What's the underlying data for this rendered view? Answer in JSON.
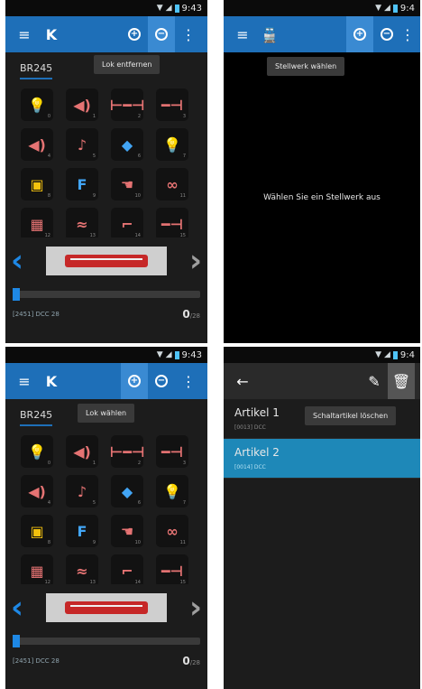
{
  "status": {
    "time_full": "9:43",
    "time_cut": "9:4"
  },
  "screen_tl": {
    "tooltip": "Lok entfernen",
    "lok_tab": "BR245",
    "address": "[2451] DCC 28",
    "speed_value": "0",
    "speed_max": "/28",
    "speed_fraction": 0.0,
    "icons": {
      "menu": "menu-icon",
      "app": "k-logo-icon",
      "add": "add-circle-icon",
      "remove": "remove-circle-icon",
      "more": "more-vert-icon"
    },
    "functions": [
      {
        "icon": "lightbulb-icon",
        "glyph": "💡",
        "color": "#f4c20d",
        "num": "0"
      },
      {
        "icon": "horn-icon",
        "glyph": "◀)",
        "color": "#e57373",
        "num": "1"
      },
      {
        "icon": "coupler-icon",
        "glyph": "⊢━⊣",
        "color": "#e57373",
        "num": "2"
      },
      {
        "icon": "coupler-icon",
        "glyph": "━⊣",
        "color": "#e57373",
        "num": "3"
      },
      {
        "icon": "horn-icon",
        "glyph": "◀)",
        "color": "#e57373",
        "num": "4"
      },
      {
        "icon": "whistle-icon",
        "glyph": "♪",
        "color": "#e57373",
        "num": "5"
      },
      {
        "icon": "shunting-icon",
        "glyph": "◆",
        "color": "#42a5f5",
        "num": "6"
      },
      {
        "icon": "lightbulb-icon",
        "glyph": "💡",
        "color": "#f4c20d",
        "num": "7"
      },
      {
        "icon": "cab-light-icon",
        "glyph": "▣",
        "color": "#f4c20d",
        "num": "8"
      },
      {
        "icon": "function-f-icon",
        "glyph": "F",
        "color": "#42a5f5",
        "num": "9"
      },
      {
        "icon": "hand-icon",
        "glyph": "☚",
        "color": "#e57373",
        "num": "10"
      },
      {
        "icon": "link-icon",
        "glyph": "∞",
        "color": "#e57373",
        "num": "11"
      },
      {
        "icon": "grid-icon",
        "glyph": "▦",
        "color": "#e57373",
        "num": "12"
      },
      {
        "icon": "brake-icon",
        "glyph": "≈",
        "color": "#e57373",
        "num": "13"
      },
      {
        "icon": "crane-icon",
        "glyph": "⌐",
        "color": "#e57373",
        "num": "14"
      },
      {
        "icon": "coupler-icon",
        "glyph": "━⊣",
        "color": "#e57373",
        "num": "15"
      }
    ]
  },
  "screen_tr": {
    "tooltip": "Stellwerk wählen",
    "message": "Wählen Sie ein Stellwerk aus"
  },
  "screen_bl": {
    "tooltip": "Lok wählen",
    "lok_tab": "BR245",
    "address": "[2451] DCC 28",
    "speed_value": "0",
    "speed_max": "/28",
    "speed_fraction": 0.0
  },
  "screen_br": {
    "tooltip": "Schaltartikel löschen",
    "items": [
      {
        "title": "Artikel 1",
        "sub": "[0013] DCC"
      },
      {
        "title": "Artikel 2",
        "sub": "[0014] DCC"
      }
    ]
  },
  "colors": {
    "appbar": "#1e6fb8",
    "accent": "#1e88e5",
    "selected": "#1e88b8"
  }
}
